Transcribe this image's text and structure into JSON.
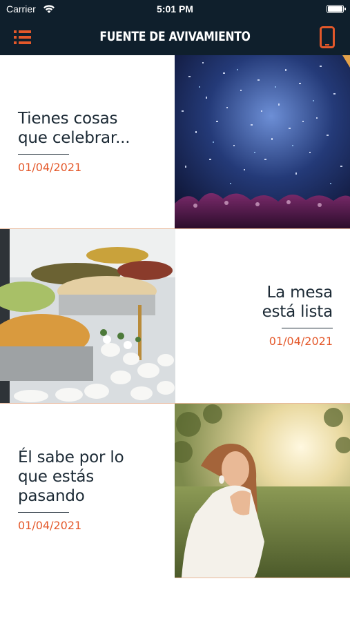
{
  "statusbar": {
    "carrier": "Carrier",
    "time": "5:01 PM"
  },
  "navbar": {
    "title": "FUENTE DE AVIVAMIENTO",
    "menu_icon": "menu-list-icon",
    "phone_icon": "smartphone-icon"
  },
  "colors": {
    "bar": "#0f1f2c",
    "accent": "#e4582a",
    "text": "#1c2a35"
  },
  "articles": [
    {
      "title_lines": [
        "Tienes cosas",
        "que celebrar..."
      ],
      "date": "01/04/2021",
      "image": "confetti-concert-photo"
    },
    {
      "title_lines": [
        "La mesa",
        "está lista"
      ],
      "date": "01/04/2021",
      "image": "buffet-table-photo"
    },
    {
      "title_lines": [
        "Él sabe por lo",
        "que estás",
        "pasando"
      ],
      "date": "01/04/2021",
      "image": "woman-praying-photo"
    }
  ]
}
